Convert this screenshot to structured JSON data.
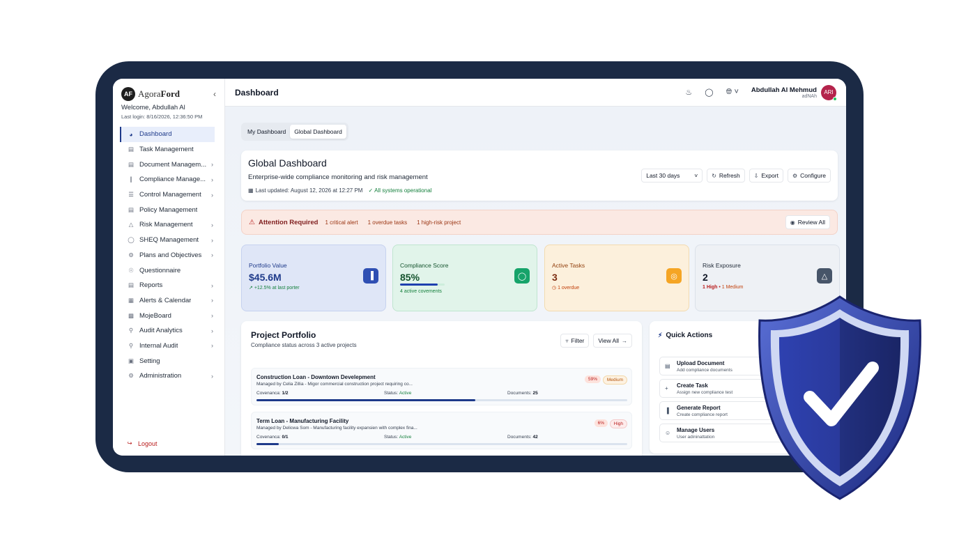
{
  "sidebar": {
    "brand_prefix": "Agora",
    "brand_suffix": "Ford",
    "logo_text": "AF",
    "welcome": "Welcome, Abdullah Al",
    "last_login": "Last login: 8/16/2026, 12:36:50 PM",
    "items": [
      {
        "label": "Dashboard",
        "icon": "dashboard-icon"
      },
      {
        "label": "Task Management",
        "icon": "task-icon"
      },
      {
        "label": "Document Managem...",
        "icon": "document-icon"
      },
      {
        "label": "Compliance Manage...",
        "icon": "compliance-icon"
      },
      {
        "label": "Control Management",
        "icon": "layers-icon"
      },
      {
        "label": "Policy Management",
        "icon": "policy-icon"
      },
      {
        "label": "Risk Management",
        "icon": "warning-icon"
      },
      {
        "label": "SHEQ Management",
        "icon": "shield-icon"
      },
      {
        "label": "Plans and Objectives",
        "icon": "gear-icon"
      },
      {
        "label": "Questionnaire",
        "icon": "question-icon"
      },
      {
        "label": "Reports",
        "icon": "report-icon"
      },
      {
        "label": "Alerts & Calendar",
        "icon": "calendar-icon"
      },
      {
        "label": "MojeBoard",
        "icon": "board-icon"
      },
      {
        "label": "Audit Analytics",
        "icon": "analytics-icon"
      },
      {
        "label": "Internal Audit",
        "icon": "search-icon"
      },
      {
        "label": "Setting",
        "icon": "lock-icon"
      },
      {
        "label": "Administration",
        "icon": "admin-icon"
      }
    ],
    "logout": "Logout"
  },
  "header": {
    "title": "Dashboard",
    "user_name": "Abdullah Al Mehmud",
    "user_sub": "adNAh",
    "avatar": "ARI"
  },
  "tabs": [
    "My Dashboard",
    "Global Dashboard"
  ],
  "global": {
    "title": "Global Dashboard",
    "subtitle": "Enterprise-wide compliance monitoring and risk management",
    "last_updated": "Last updated: August 12, 2026 at 12:27 PM",
    "status": "All systems operational",
    "range": "Last 30 days",
    "refresh": "Refresh",
    "export": "Export",
    "configure": "Configure"
  },
  "alert": {
    "title": "Attention Required",
    "items": [
      "1 critical alert",
      "1 overdue tasks",
      "1 high-risk project"
    ],
    "button": "Review All"
  },
  "stats": [
    {
      "label": "Portfolio Value",
      "value": "$45.6M",
      "sub": "+12.5% at last porter",
      "icon": "bar-chart-icon",
      "color": "#2f4fb3"
    },
    {
      "label": "Compliance Score",
      "value": "85%",
      "sub": "4 active covements",
      "icon": "shield-icon",
      "color": "#16a36a",
      "progress": 0.85
    },
    {
      "label": "Active Tasks",
      "value": "3",
      "sub": "1 overdue",
      "icon": "target-icon",
      "color": "#f5a524"
    },
    {
      "label": "Risk Exposure",
      "value": "2",
      "sub_high": "1 High",
      "sub_medium": "1 Medium",
      "icon": "warning-icon",
      "color": "#475569"
    }
  ],
  "portfolio": {
    "title": "Project Portfolio",
    "subtitle": "Compliance status across 3 active projects",
    "filter": "Filter",
    "view_all": "View All",
    "projects": [
      {
        "name": "Construction Loan - Downtown Develepment",
        "desc": "Managed by Celia Zillia - Migor commercial construction project requiring co...",
        "pct": "59%",
        "risk": "Medium",
        "covenants_label": "Covenanca:",
        "covenants": "1/2",
        "status_label": "Status:",
        "status": "Active",
        "docs_label": "Documents:",
        "docs": "25",
        "progress": 0.59
      },
      {
        "name": "Term Loan - Manufacturing Facility",
        "desc": "Managed by Delicwa Som - Manufacturing facility expansien with complex fina...",
        "pct": "6%",
        "risk": "High",
        "covenants_label": "Covenanca:",
        "covenants": "0/1",
        "status_label": "Status:",
        "status": "Active",
        "docs_label": "Documents:",
        "docs": "42",
        "progress": 0.06
      }
    ]
  },
  "quick_actions": {
    "title": "Quick Actions",
    "items": [
      {
        "name": "Upload Document",
        "desc": "Add compliance documents",
        "icon": "document-icon"
      },
      {
        "name": "Create Task",
        "desc": "Assign new compliance test",
        "icon": "plus-icon"
      },
      {
        "name": "Generate Report",
        "desc": "Create compliance report",
        "icon": "chart-icon"
      },
      {
        "name": "Manage Users",
        "desc": "User adininattation",
        "icon": "users-icon"
      }
    ]
  }
}
